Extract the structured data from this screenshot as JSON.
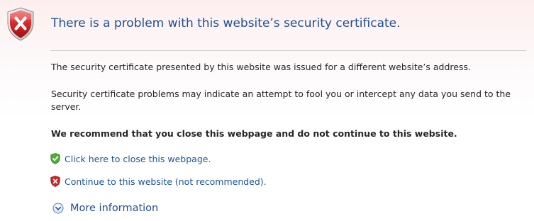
{
  "header": {
    "title": "There is a problem with this website’s security certificate.",
    "icon": "error-shield-icon"
  },
  "body": {
    "paragraph_1": "The security certificate presented by this website was issued for a different website’s address.",
    "paragraph_2": "Security certificate problems may indicate an attempt to fool you or intercept any data you send to the server.",
    "recommendation": "We recommend that you close this webpage and do not continue to this website."
  },
  "actions": {
    "close_page": {
      "label": "Click here to close this webpage.",
      "icon": "green-check-shield-icon"
    },
    "continue": {
      "label": "Continue to this website (not recommended).",
      "icon": "red-x-shield-icon"
    },
    "more_info": {
      "label": "More information",
      "icon": "expand-down-circle-icon"
    }
  },
  "colors": {
    "title": "#1f4e95",
    "link": "#1a5699",
    "error_red": "#c8171e",
    "safe_green": "#3b9b24"
  }
}
